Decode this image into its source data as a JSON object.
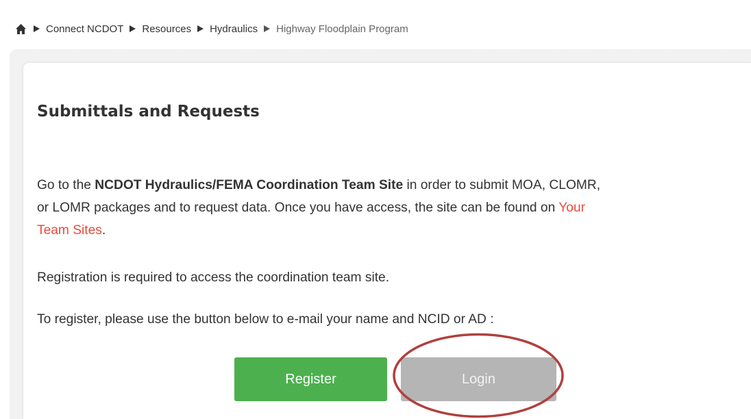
{
  "breadcrumb": {
    "home_icon": "home-icon",
    "items": [
      "Connect NCDOT",
      "Resources",
      "Hydraulics"
    ],
    "current": "Highway Floodplain Program"
  },
  "page": {
    "title": "Submittals and Requests"
  },
  "paragraph1": {
    "line1_prefix": "Go to the ",
    "line1_bold": "NCDOT Hydraulics/FEMA Coordination Team Site",
    "line1_suffix": " in order to submit MOA, CLOMR,",
    "line2_text": "or LOMR packages and to request data.  Once you have access, the site can be found on ",
    "line2_link": "Your",
    "line3_link": "Team Sites",
    "line3_suffix": "."
  },
  "paragraph2": "Registration is required to access the coordination team site.",
  "paragraph3": "To register, please use the button below to e-mail your name and NCID or AD :",
  "buttons": {
    "register_label": "Register",
    "login_label": "Login"
  },
  "colors": {
    "register_green": "#4cb04f",
    "login_gray": "#b5b5b5",
    "link_red": "#e74c3c",
    "annotation_circle": "#b0403e"
  }
}
